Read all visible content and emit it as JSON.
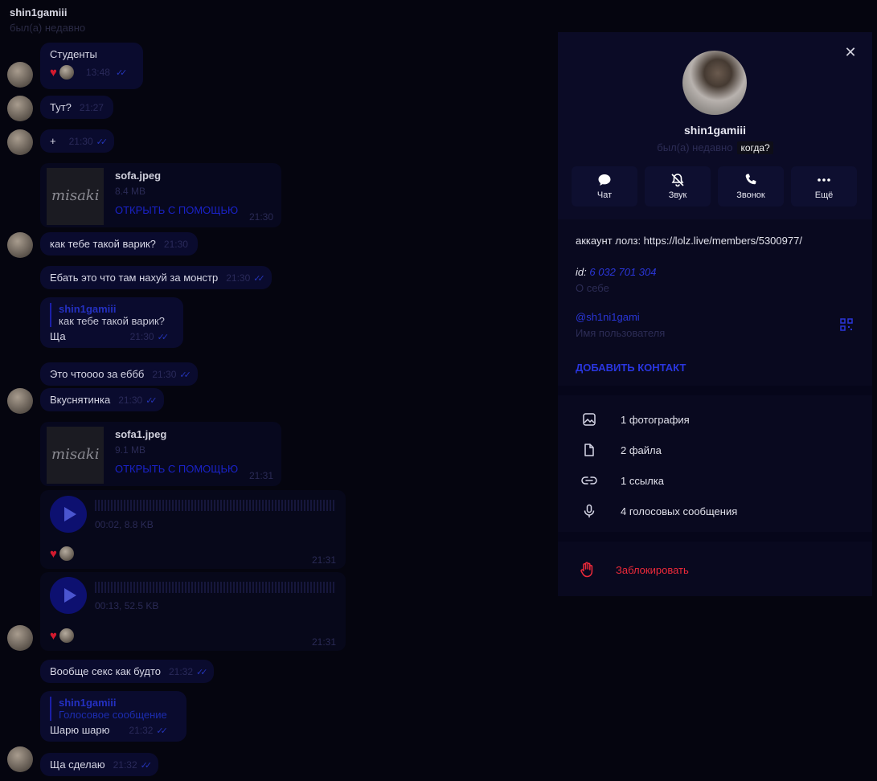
{
  "header": {
    "name": "shin1gamiii",
    "status": "был(а) недавно"
  },
  "messages": {
    "m1": {
      "text": "Студенты",
      "time": "13:48"
    },
    "m2": {
      "text": "Тут?",
      "time": "21:27"
    },
    "m3": {
      "text": "+",
      "time": "21:30"
    },
    "file1": {
      "thumb_text": "misaki",
      "name": "sofa.jpeg",
      "size": "8.4 MB",
      "open": "ОТКРЫТЬ С ПОМОЩЬЮ",
      "time": "21:30"
    },
    "m4": {
      "text": "как тебе такой варик?",
      "time": "21:30"
    },
    "m5": {
      "text": "Ебать это что там нахуй за монстр",
      "time": "21:30"
    },
    "m6": {
      "reply_name": "shin1gamiii",
      "reply_text": "как тебе такой варик?",
      "text": "Ща",
      "time": "21:30"
    },
    "m7": {
      "text": "Это чтоооо за еббб",
      "time": "21:30"
    },
    "m8": {
      "text": "Вкуснятинка",
      "time": "21:30"
    },
    "file2": {
      "thumb_text": "misaki",
      "name": "sofa1.jpeg",
      "size": "9.1 MB",
      "open": "ОТКРЫТЬ С ПОМОЩЬЮ",
      "time": "21:31"
    },
    "voice1": {
      "meta": "00:02, 8.8 KB",
      "time": "21:31"
    },
    "voice2": {
      "meta": "00:13, 52.5 KB",
      "time": "21:31"
    },
    "m9": {
      "text": "Вообще секс как будто",
      "time": "21:32"
    },
    "m10": {
      "reply_name": "shin1gamiii",
      "reply_text": "Голосовое сообщение",
      "text": "Шарю шарю",
      "time": "21:32"
    },
    "m11": {
      "text": "Ща сделаю",
      "time": "21:32"
    }
  },
  "panel": {
    "name": "shin1gamiii",
    "status": "был(а) недавно",
    "tooltip": "когда?",
    "actions": [
      {
        "label": "Чат",
        "icon": "chat-icon"
      },
      {
        "label": "Звук",
        "icon": "bell-off-icon"
      },
      {
        "label": "Звонок",
        "icon": "phone-icon"
      },
      {
        "label": "Ещё",
        "icon": "more-icon"
      }
    ],
    "bio": "аккаунт лолз: https://lolz.live/members/5300977/",
    "id_label": "id:",
    "id_value": "6 032 701 304",
    "about_label": "О себе",
    "username": "@sh1ni1gami",
    "username_label": "Имя пользователя",
    "add_contact": "ДОБАВИТЬ КОНТАКТ",
    "media": [
      {
        "label": "1 фотография",
        "icon": "photo-icon"
      },
      {
        "label": "2 файла",
        "icon": "file-icon"
      },
      {
        "label": "1 ссылка",
        "icon": "link-icon"
      },
      {
        "label": "4 голосовых сообщения",
        "icon": "mic-icon"
      }
    ],
    "block": "Заблокировать"
  },
  "colors": {
    "accent": "#2a36d8",
    "danger": "#f02a3a",
    "bubble": "#0a0b2e",
    "background": "#05050f"
  }
}
